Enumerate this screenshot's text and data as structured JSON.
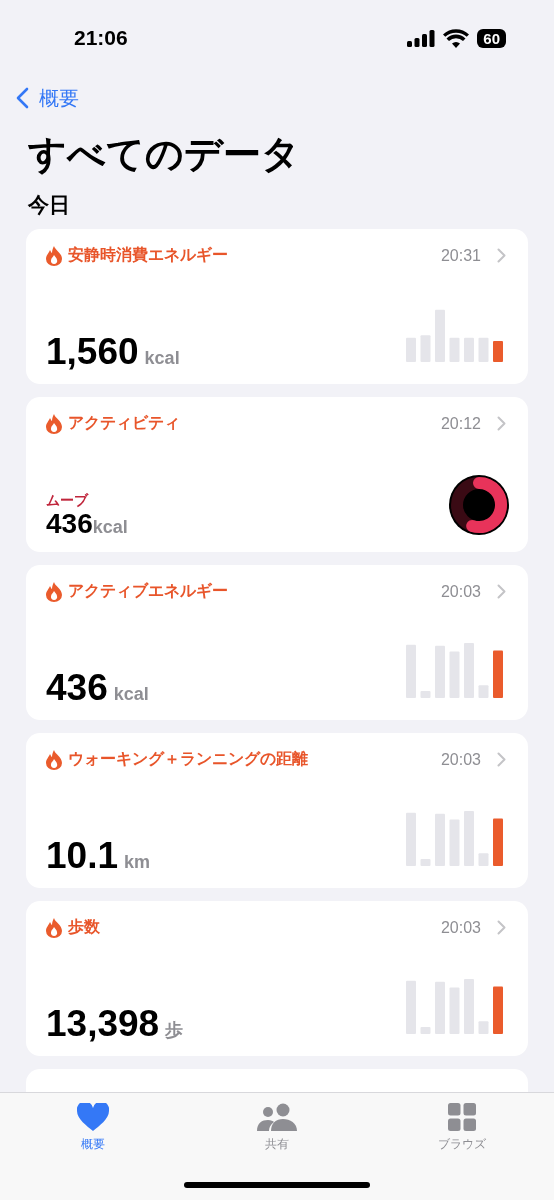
{
  "status_bar": {
    "time": "21:06",
    "battery": "60"
  },
  "nav": {
    "back": "概要"
  },
  "title": "すべてのデータ",
  "section": "今日",
  "cards": [
    {
      "kind": "bars",
      "title": "安静時消費エネルギー",
      "time": "20:31",
      "value": "1,560",
      "unit": "kcal"
    },
    {
      "kind": "ring",
      "title": "アクティビティ",
      "time": "20:12",
      "label": "ムーブ",
      "value": "436",
      "unit": "kcal"
    },
    {
      "kind": "bars",
      "title": "アクティブエネルギー",
      "time": "20:03",
      "value": "436",
      "unit": "kcal"
    },
    {
      "kind": "bars",
      "title": "ウォーキング＋ランニングの距離",
      "time": "20:03",
      "value": "10.1",
      "unit": "km"
    },
    {
      "kind": "bars",
      "title": "歩数",
      "time": "20:03",
      "value": "13,398",
      "unit": "歩"
    }
  ],
  "tab_bar": [
    {
      "kind": "heart",
      "label": "概要",
      "selected": true
    },
    {
      "kind": "people",
      "label": "共有",
      "selected": false
    },
    {
      "kind": "grid",
      "label": "ブラウズ",
      "selected": false
    }
  ]
}
